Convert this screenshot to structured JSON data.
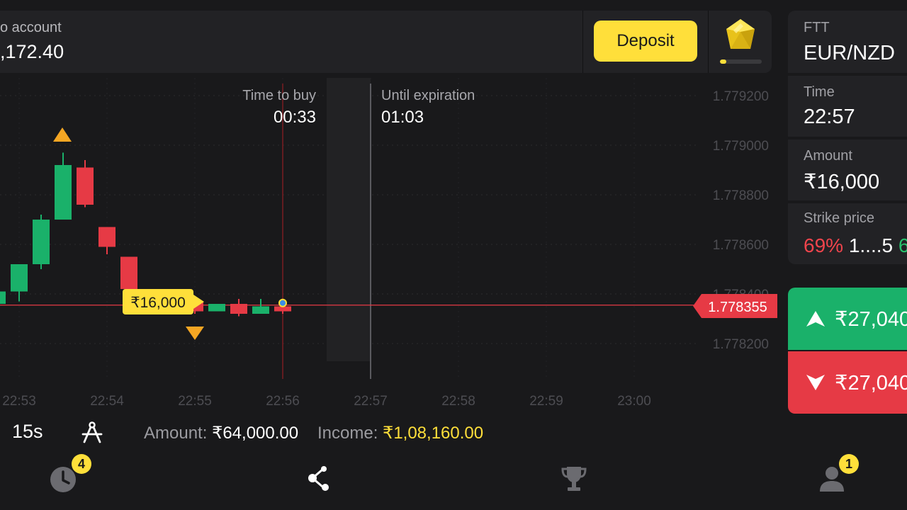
{
  "account": {
    "label": "o account",
    "balance": ",172.40",
    "deposit_label": "Deposit",
    "level_progress": 0.15
  },
  "info_panel": {
    "asset_type": "FTT",
    "asset_pair": "EUR/NZD",
    "time_label": "Time",
    "time_value": "22:57",
    "amount_label": "Amount",
    "amount_value": "₹16,000",
    "strike_label": "Strike price",
    "strike_pct_down": "69%",
    "strike_value": "1....5",
    "strike_pct_up": "6("
  },
  "trade": {
    "up_payout": "₹27,040.",
    "down_payout": "₹27,040."
  },
  "chart_data": {
    "type": "candlestick",
    "price_ticks": [
      "1.779200",
      "1.779000",
      "1.778800",
      "1.778600",
      "1.778400",
      "1.778200"
    ],
    "time_ticks": [
      "22:53",
      "22:54",
      "22:55",
      "22:56",
      "22:57",
      "22:58",
      "22:59",
      "23:00"
    ],
    "ylim": [
      1.77812,
      1.77922
    ],
    "current_price": "1.778355",
    "current_price_value": 1.778355,
    "time_to_buy_label": "Time to buy",
    "time_to_buy": "00:33",
    "until_expiration_label": "Until expiration",
    "until_expiration": "01:03",
    "trade_marker_amount": "₹16,000",
    "candles": [
      {
        "t": "22:52:45",
        "o": 1.77836,
        "h": 1.77842,
        "l": 1.77832,
        "c": 1.77841,
        "dir": "up"
      },
      {
        "t": "22:53:00",
        "o": 1.77841,
        "h": 1.77852,
        "l": 1.77837,
        "c": 1.77852,
        "dir": "up"
      },
      {
        "t": "22:53:15",
        "o": 1.77852,
        "h": 1.77872,
        "l": 1.7785,
        "c": 1.7787,
        "dir": "up"
      },
      {
        "t": "22:53:30",
        "o": 1.7787,
        "h": 1.77897,
        "l": 1.7787,
        "c": 1.77892,
        "dir": "up"
      },
      {
        "t": "22:53:45",
        "o": 1.77891,
        "h": 1.77894,
        "l": 1.77875,
        "c": 1.77876,
        "dir": "down"
      },
      {
        "t": "22:54:00",
        "o": 1.77867,
        "h": 1.77867,
        "l": 1.77856,
        "c": 1.77859,
        "dir": "down"
      },
      {
        "t": "22:54:15",
        "o": 1.77855,
        "h": 1.77855,
        "l": 1.77841,
        "c": 1.77842,
        "dir": "down"
      },
      {
        "t": "22:54:30",
        "o": 1.77842,
        "h": 1.77842,
        "l": 1.77838,
        "c": 1.77839,
        "dir": "down"
      },
      {
        "t": "22:54:45",
        "o": 1.77839,
        "h": 1.77842,
        "l": 1.77835,
        "c": 1.77836,
        "dir": "down"
      },
      {
        "t": "22:55:00",
        "o": 1.77837,
        "h": 1.77837,
        "l": 1.77832,
        "c": 1.77833,
        "dir": "down"
      },
      {
        "t": "22:55:15",
        "o": 1.77833,
        "h": 1.77836,
        "l": 1.77833,
        "c": 1.77836,
        "dir": "up"
      },
      {
        "t": "22:55:30",
        "o": 1.77836,
        "h": 1.77838,
        "l": 1.77831,
        "c": 1.77832,
        "dir": "down"
      },
      {
        "t": "22:55:45",
        "o": 1.77832,
        "h": 1.77838,
        "l": 1.77832,
        "c": 1.77835,
        "dir": "up"
      },
      {
        "t": "22:56:00",
        "o": 1.77835,
        "h": 1.77836,
        "l": 1.77832,
        "c": 1.77833,
        "dir": "down"
      }
    ]
  },
  "toolbar": {
    "timeframe": "15s",
    "amount_label": "Amount:",
    "amount_value": "₹64,000.00",
    "income_label": "Income:",
    "income_value": "₹1,08,160.00"
  },
  "nav": {
    "history_badge": "4",
    "profile_badge": "1"
  },
  "colors": {
    "up": "#1ab16a",
    "down": "#e63a45",
    "accent": "#ffdf3a",
    "marker": "#f5a623"
  }
}
